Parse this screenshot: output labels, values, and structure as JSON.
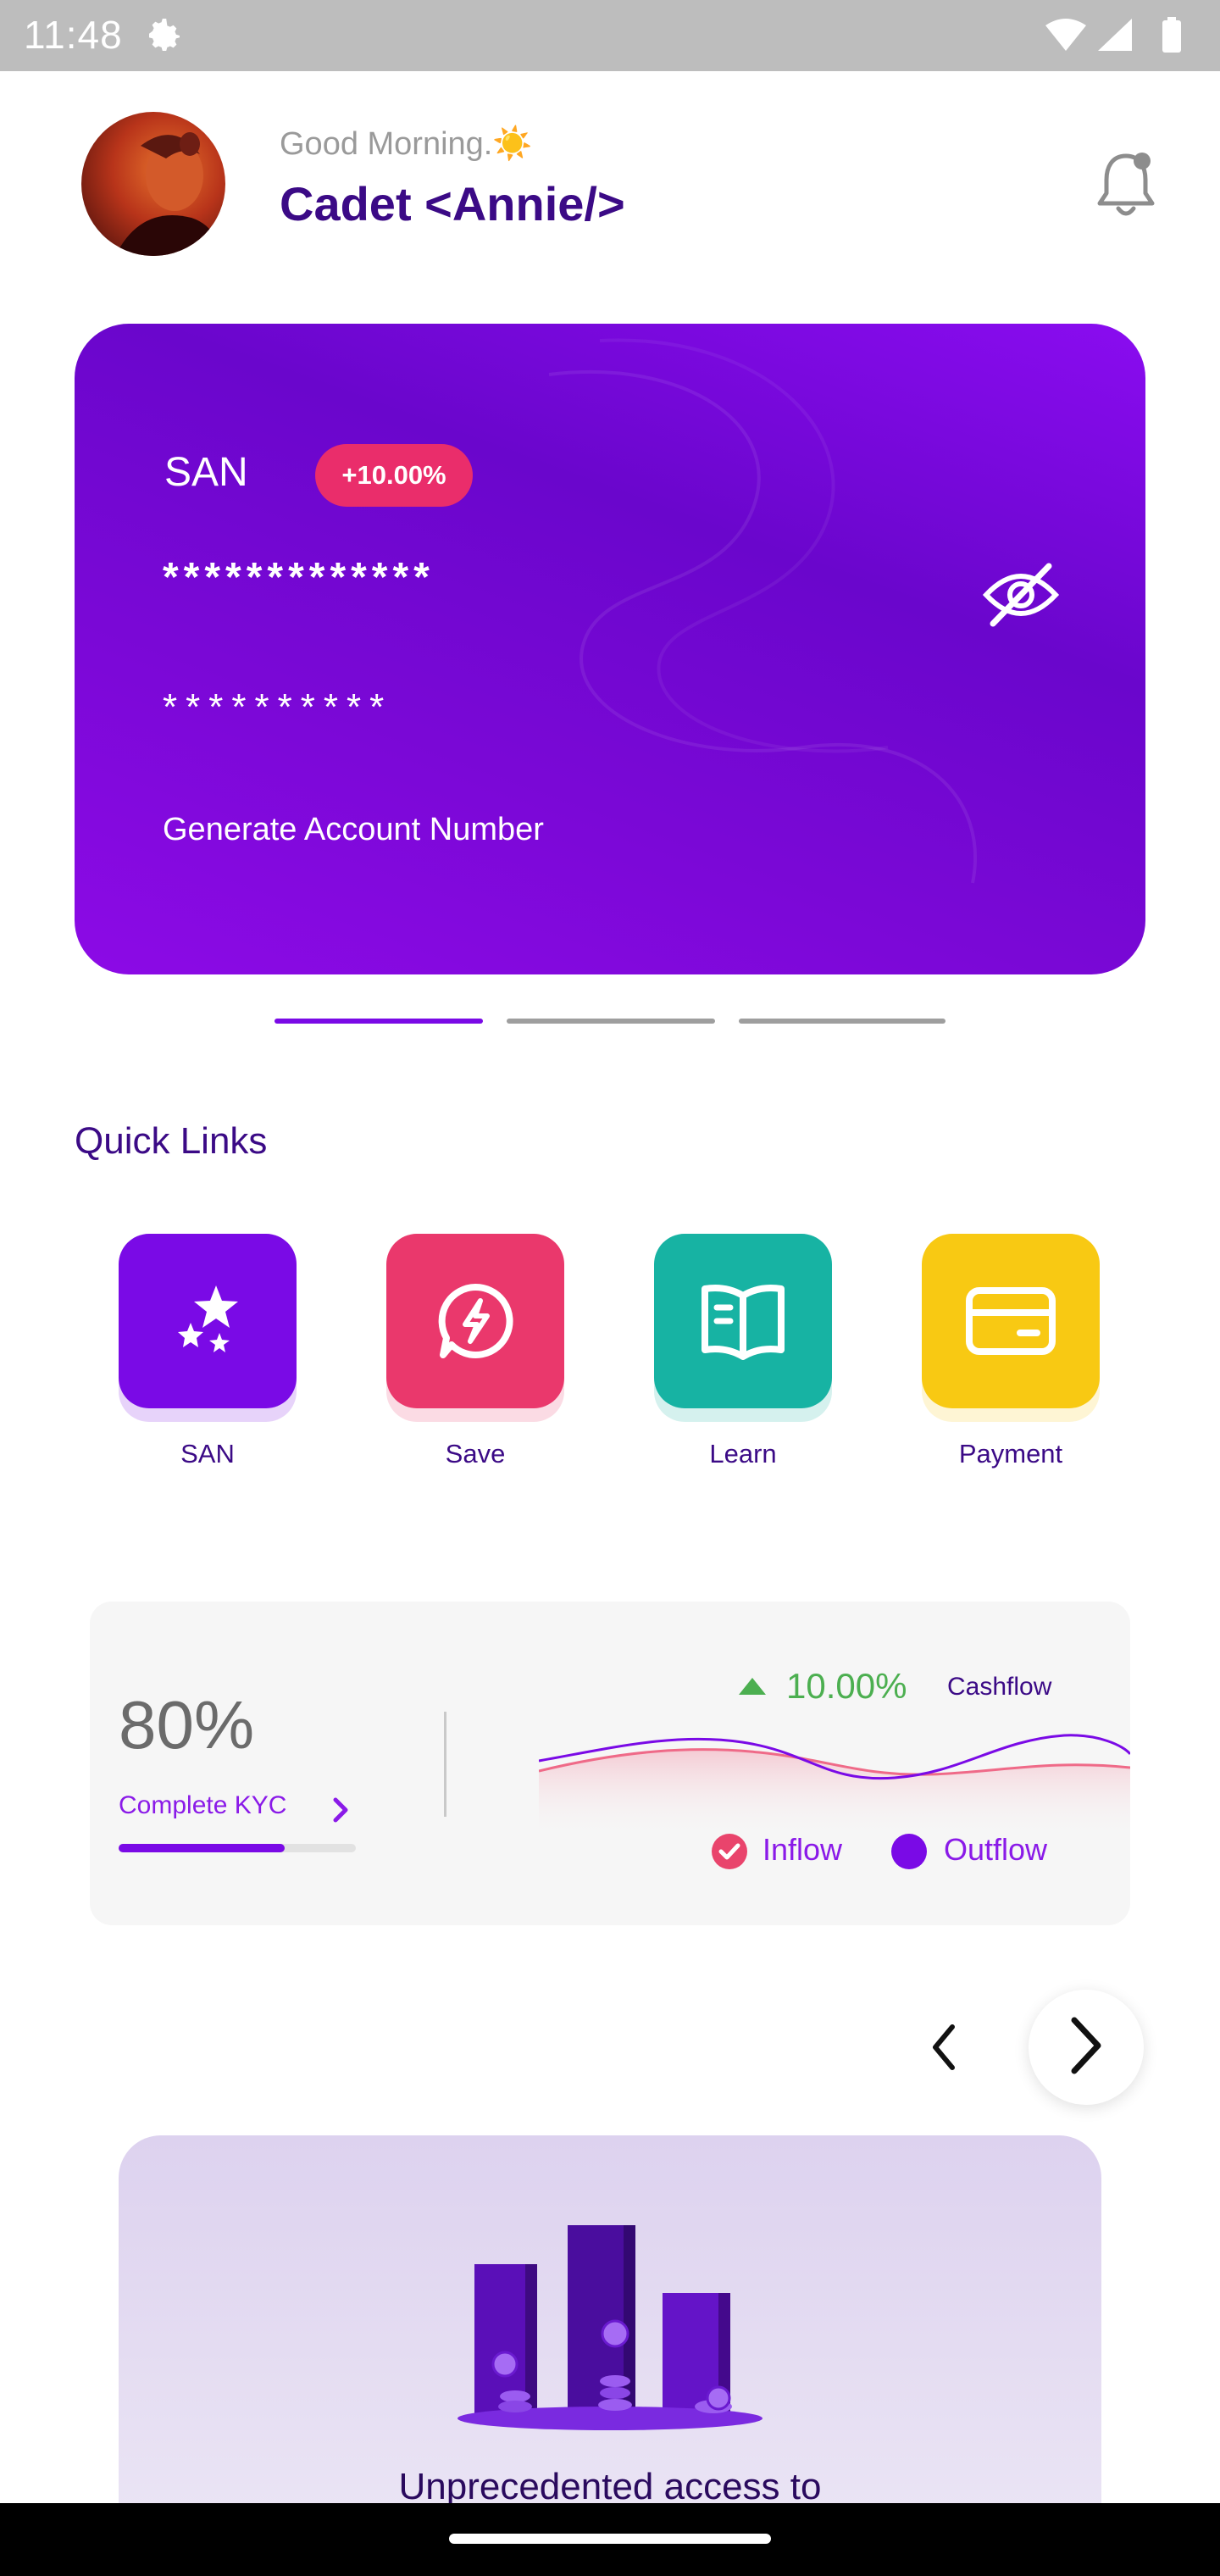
{
  "status_bar": {
    "time": "11:48"
  },
  "header": {
    "greeting": "Good Morning.☀️",
    "user_name": "Cadet <Annie/>"
  },
  "card": {
    "label": "SAN",
    "badge": "+10.00%",
    "masked_balance": "*************",
    "masked_account": "**********",
    "generate_label": "Generate Account Number"
  },
  "carousel_pages": {
    "count": 3,
    "active_index": 0
  },
  "quick_links": {
    "title": "Quick Links",
    "items": [
      {
        "label": "SAN",
        "icon": "stars-icon",
        "color": "#7a0ae6"
      },
      {
        "label": "Save",
        "icon": "lightning-chat-icon",
        "color": "#ea386c"
      },
      {
        "label": "Learn",
        "icon": "book-icon",
        "color": "#17b3a3"
      },
      {
        "label": "Payment",
        "icon": "card-icon",
        "color": "#f8c913"
      }
    ]
  },
  "kyc": {
    "percent": "80%",
    "link_label": "Complete KYC",
    "progress": 0.7
  },
  "cashflow": {
    "change": "10.00%",
    "title": "Cashflow",
    "legend": {
      "inflow": "Inflow",
      "outflow": "Outflow"
    },
    "colors": {
      "inflow": "#e9446c",
      "outflow": "#7a0ae6",
      "up": "#4caf50"
    }
  },
  "promo": {
    "text": "Unprecedented access to"
  },
  "colors": {
    "brand_dark": "#3b0a86",
    "brand": "#7a0ae6",
    "pink": "#ea2d6b"
  }
}
